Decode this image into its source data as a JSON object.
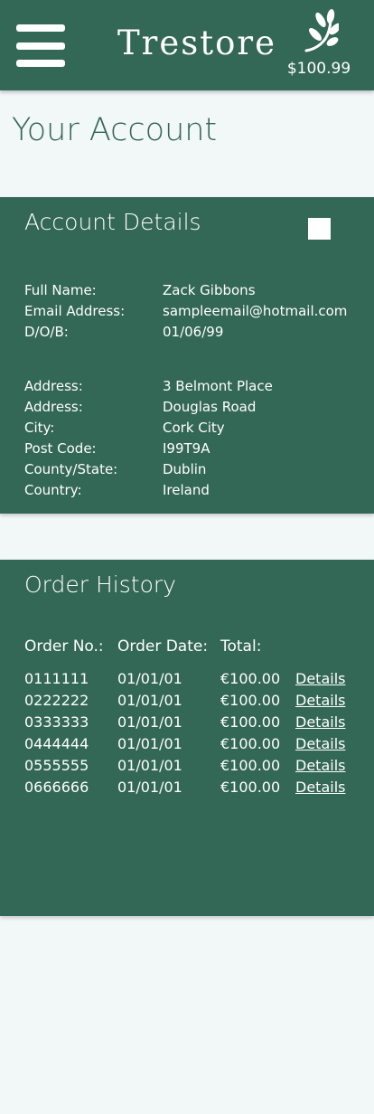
{
  "header": {
    "brand": "Trestore",
    "balance": "$100.99",
    "menu_icon": "hamburger-menu-icon",
    "logo_icon": "leaf-icon"
  },
  "page": {
    "title": "Your Account"
  },
  "account_details": {
    "title": "Account Details",
    "edit_icon": "white-square-icon",
    "personal": [
      {
        "label": "Full Name:",
        "value": "Zack Gibbons"
      },
      {
        "label": "Email Address:",
        "value": "sampleemail@hotmail.com"
      },
      {
        "label": "D/O/B:",
        "value": "01/06/99"
      }
    ],
    "address": [
      {
        "label": "Address:",
        "value": "3 Belmont Place"
      },
      {
        "label": "Address:",
        "value": "Douglas Road"
      },
      {
        "label": "City:",
        "value": "Cork City"
      },
      {
        "label": "Post Code:",
        "value": "I99T9A"
      },
      {
        "label": "County/State:",
        "value": "Dublin"
      },
      {
        "label": "Country:",
        "value": "Ireland"
      }
    ]
  },
  "order_history": {
    "title": "Order History",
    "columns": [
      "Order No.:",
      "Order Date:",
      "Total:"
    ],
    "rows": [
      {
        "number": "0111111",
        "date": "01/01/01",
        "total": "€100.00",
        "link": "Details"
      },
      {
        "number": "0222222",
        "date": "01/01/01",
        "total": "€100.00",
        "link": "Details"
      },
      {
        "number": "0333333",
        "date": "01/01/01",
        "total": "€100.00",
        "link": "Details"
      },
      {
        "number": "0444444",
        "date": "01/01/01",
        "total": "€100.00",
        "link": "Details"
      },
      {
        "number": "0555555",
        "date": "01/01/01",
        "total": "€100.00",
        "link": "Details"
      },
      {
        "number": "0666666",
        "date": "01/01/01",
        "total": "€100.00",
        "link": "Details"
      }
    ]
  },
  "colors": {
    "primary": "#336756",
    "background": "#f2f7f7",
    "text_on_primary": "#ffffff"
  }
}
